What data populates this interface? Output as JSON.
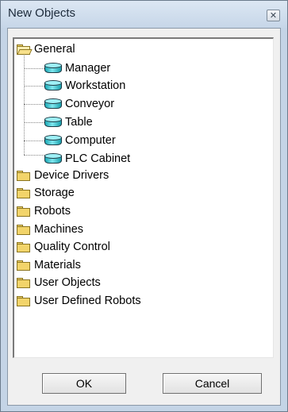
{
  "window": {
    "title": "New Objects",
    "close_symbol": "✕"
  },
  "tree": {
    "root": {
      "label": "General",
      "icon": "folder-open-icon",
      "expanded": true,
      "children": [
        {
          "label": "Manager",
          "icon": "cylinder-icon"
        },
        {
          "label": "Workstation",
          "icon": "cylinder-icon"
        },
        {
          "label": "Conveyor",
          "icon": "cylinder-icon"
        },
        {
          "label": "Table",
          "icon": "cylinder-icon"
        },
        {
          "label": "Computer",
          "icon": "cylinder-icon"
        },
        {
          "label": "PLC Cabinet",
          "icon": "cylinder-icon"
        }
      ]
    },
    "folders": [
      {
        "label": "Device Drivers",
        "icon": "folder-icon"
      },
      {
        "label": "Storage",
        "icon": "folder-icon"
      },
      {
        "label": "Robots",
        "icon": "folder-icon"
      },
      {
        "label": "Machines",
        "icon": "folder-icon"
      },
      {
        "label": "Quality Control",
        "icon": "folder-icon"
      },
      {
        "label": "Materials",
        "icon": "folder-icon"
      },
      {
        "label": "User Objects",
        "icon": "folder-icon"
      },
      {
        "label": "User Defined Robots",
        "icon": "folder-icon"
      }
    ]
  },
  "buttons": {
    "ok_label": "OK",
    "cancel_label": "Cancel"
  }
}
